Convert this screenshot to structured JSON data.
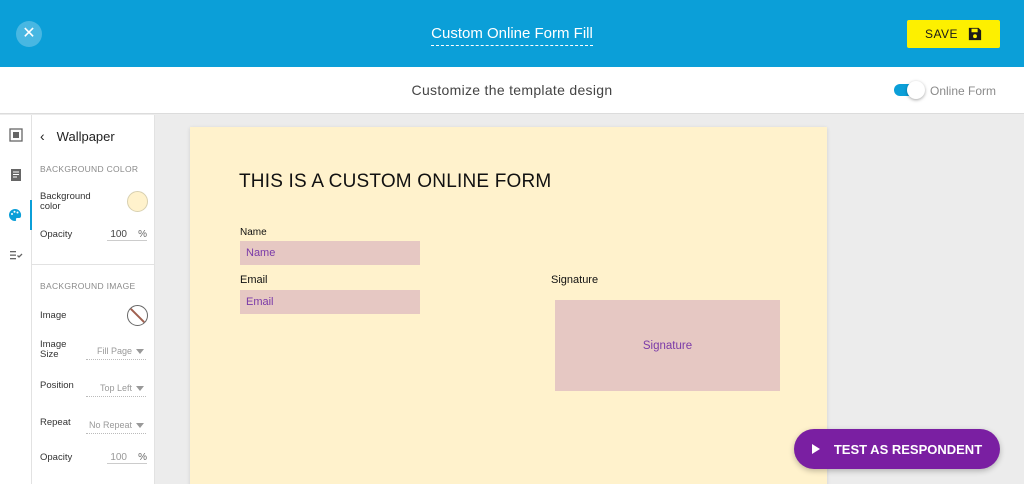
{
  "header": {
    "title": "Custom Online Form Fill",
    "save_label": "SAVE",
    "close_icon": "close-icon",
    "save_icon": "floppy-disk-icon"
  },
  "subheader": {
    "title": "Customize the template design",
    "toggle_label": "Online Form",
    "toggle_on": true
  },
  "rail": {
    "items": [
      {
        "name": "layout",
        "icon": "layout-icon"
      },
      {
        "name": "content",
        "icon": "document-icon"
      },
      {
        "name": "style",
        "icon": "palette-icon",
        "active": true
      },
      {
        "name": "settings",
        "icon": "checklist-icon"
      }
    ]
  },
  "panel": {
    "title": "Wallpaper",
    "background_color_section": "BACKGROUND COLOR",
    "background_color_label_1": "Background",
    "background_color_label_2": "color",
    "background_color_value": "#fff2cc",
    "opacity_label": "Opacity",
    "opacity_value": "100",
    "opacity_unit": "%",
    "background_image_section": "BACKGROUND IMAGE",
    "image_label": "Image",
    "image_size_label_1": "Image",
    "image_size_label_2": "Size",
    "image_size_value": "Fill Page",
    "position_label": "Position",
    "position_value": "Top Left",
    "repeat_label": "Repeat",
    "repeat_value": "No Repeat",
    "opacity2_label": "Opacity",
    "opacity2_value": "100",
    "opacity2_unit": "%"
  },
  "canvas": {
    "heading": "THIS IS A CUSTOM ONLINE FORM",
    "background": "#fff2cc",
    "name_label": "Name",
    "name_placeholder": "Name",
    "email_label": "Email",
    "email_placeholder": "Email",
    "signature_label": "Signature",
    "signature_placeholder": "Signature"
  },
  "test_button": {
    "label": "TEST AS RESPONDENT"
  },
  "colors": {
    "header": "#0b9fd8",
    "save": "#fdf000",
    "accent": "#7a1fa2",
    "field_fill": "#e6c8c3"
  }
}
